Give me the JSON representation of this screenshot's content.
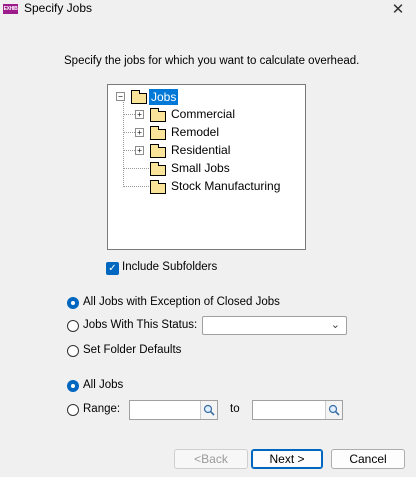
{
  "window": {
    "title": "Specify Jobs",
    "app_icon_text": "EXHIB",
    "close_glyph": "✕"
  },
  "instruction": "Specify the jobs for which you want to calculate overhead.",
  "tree": {
    "root": {
      "label": "Jobs",
      "expander": "−",
      "selected": true
    },
    "children": [
      {
        "label": "Commercial",
        "expander": "+"
      },
      {
        "label": "Remodel",
        "expander": "+"
      },
      {
        "label": "Residential",
        "expander": "+"
      },
      {
        "label": "Small Jobs",
        "expander": ""
      },
      {
        "label": "Stock Manufacturing",
        "expander": ""
      }
    ]
  },
  "include_subfolders": {
    "label": "Include Subfolders",
    "checked": true,
    "check_glyph": "✓"
  },
  "job_filter": {
    "options": [
      {
        "label": "All Jobs with Exception of Closed Jobs",
        "checked": true
      },
      {
        "label": "Jobs With This Status:",
        "checked": false
      },
      {
        "label": "Set Folder Defaults",
        "checked": false
      }
    ],
    "status_value": "",
    "chevron": "⌄"
  },
  "scope": {
    "options": [
      {
        "label": "All Jobs",
        "checked": true
      },
      {
        "label": "Range:",
        "checked": false
      }
    ],
    "range_from": "",
    "range_to_label": "to",
    "range_to": ""
  },
  "buttons": {
    "back": "<Back",
    "next": "Next >",
    "cancel": "Cancel"
  },
  "colors": {
    "accent": "#0067c0",
    "selection": "#0078d7",
    "folder": "#f9e49a",
    "app_icon": "#9b1c8a"
  }
}
